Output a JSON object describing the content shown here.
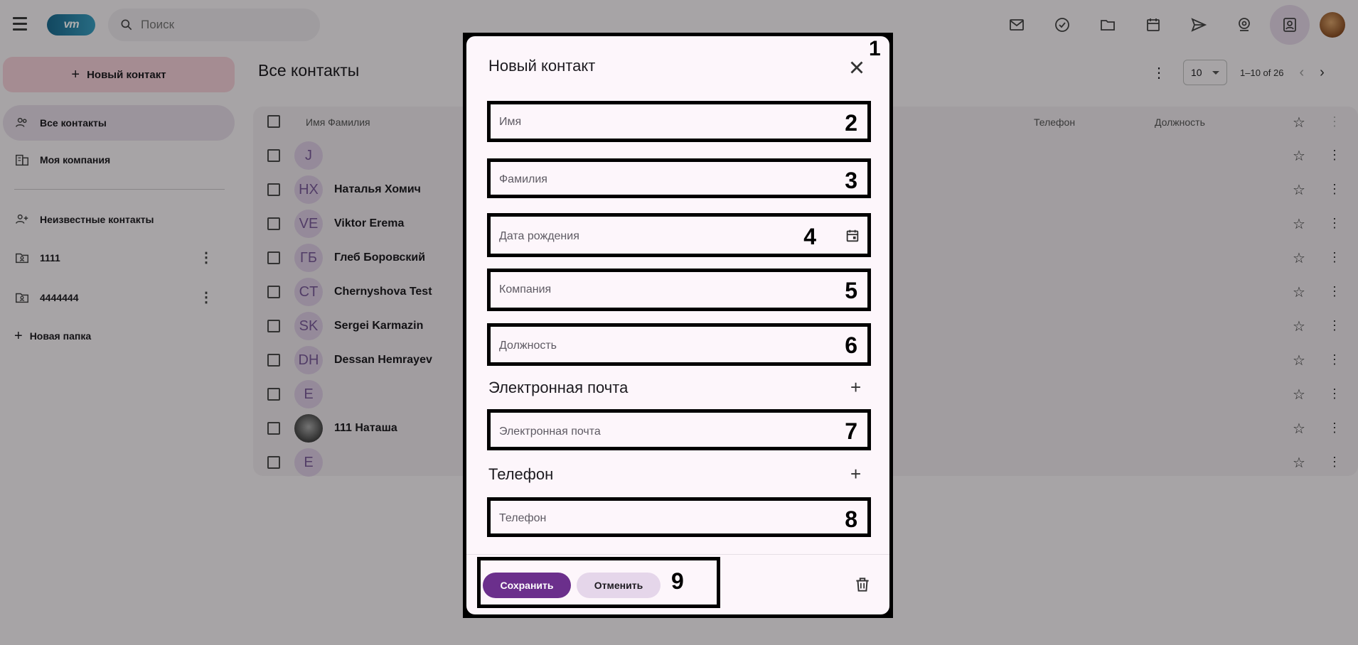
{
  "topbar": {
    "logo_text": "vm",
    "search_placeholder": "Поиск"
  },
  "sidebar": {
    "new_contact": "Новый контакт",
    "items": [
      {
        "label": "Все контакты"
      },
      {
        "label": "Моя компания"
      },
      {
        "label": "Неизвестные контакты"
      },
      {
        "label": "1111"
      },
      {
        "label": "4444444"
      },
      {
        "label": "Новая папка"
      }
    ]
  },
  "main": {
    "title": "Все контакты",
    "page_size": "10",
    "range": "1–10 of 26",
    "headers": {
      "name": "Имя Фамилия",
      "phone": "Телефон",
      "position": "Должность"
    },
    "rows": [
      {
        "initials": "J",
        "name": ""
      },
      {
        "initials": "НХ",
        "name": "Наталья Хомич"
      },
      {
        "initials": "VE",
        "name": "Viktor Erema"
      },
      {
        "initials": "ГБ",
        "name": "Глеб Боровский"
      },
      {
        "initials": "CT",
        "name": "Chernyshova Test"
      },
      {
        "initials": "SK",
        "name": "Sergei Karmazin"
      },
      {
        "initials": "DH",
        "name": "Dessan Hemrayev"
      },
      {
        "initials": "E",
        "name": ""
      },
      {
        "initials": "",
        "name": "111 Наташа"
      },
      {
        "initials": "E",
        "name": ""
      }
    ]
  },
  "dialog": {
    "title": "Новый контакт",
    "marker": "1",
    "fields": [
      {
        "placeholder": "Имя",
        "marker": "2"
      },
      {
        "placeholder": "Фамилия",
        "marker": "3"
      },
      {
        "placeholder": "Дата рождения",
        "marker": "4"
      },
      {
        "placeholder": "Компания",
        "marker": "5"
      },
      {
        "placeholder": "Должность",
        "marker": "6"
      },
      {
        "placeholder": "Электронная почта",
        "marker": "7"
      },
      {
        "placeholder": "Телефон",
        "marker": "8"
      }
    ],
    "email_section": "Электронная почта",
    "phone_section": "Телефон",
    "save": "Сохранить",
    "cancel": "Отменить",
    "footer_marker": "9"
  }
}
